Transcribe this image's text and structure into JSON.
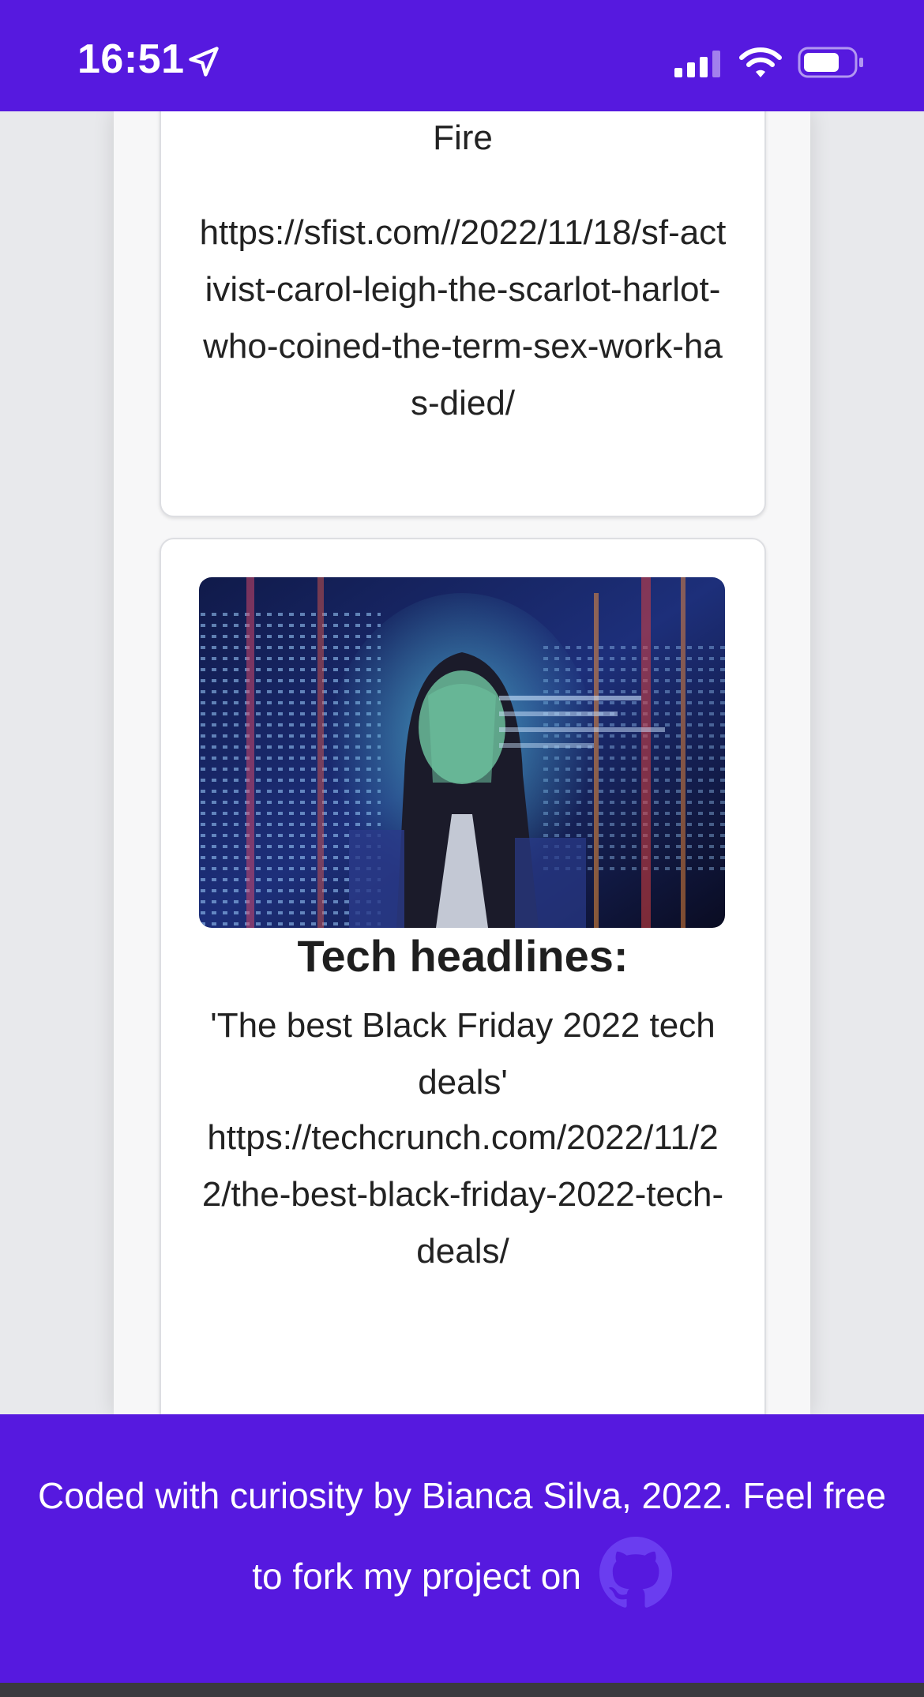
{
  "status_bar": {
    "time": "16:51",
    "icons": [
      "location-arrow-icon",
      "cellular-signal-icon",
      "wifi-icon",
      "battery-icon"
    ],
    "color": "#5619df"
  },
  "articles": [
    {
      "headline_tail": "Fire",
      "url": "https://sfist.com//2022/11/18/sf-activist-carol-leigh-the-scarlot-harlot-who-coined-the-term-sex-work-has-died/"
    },
    {
      "section_title": "Tech headlines:",
      "headline": "'The best Black Friday 2022 tech deals'",
      "url": "https://techcrunch.com/2022/11/22/the-best-black-friday-2022-tech-deals/"
    }
  ],
  "footer": {
    "text": "Coded with curiosity by Bianca Silva, 2022. Feel free to fork my project on",
    "icon": "github-icon",
    "color": "#5619df"
  }
}
